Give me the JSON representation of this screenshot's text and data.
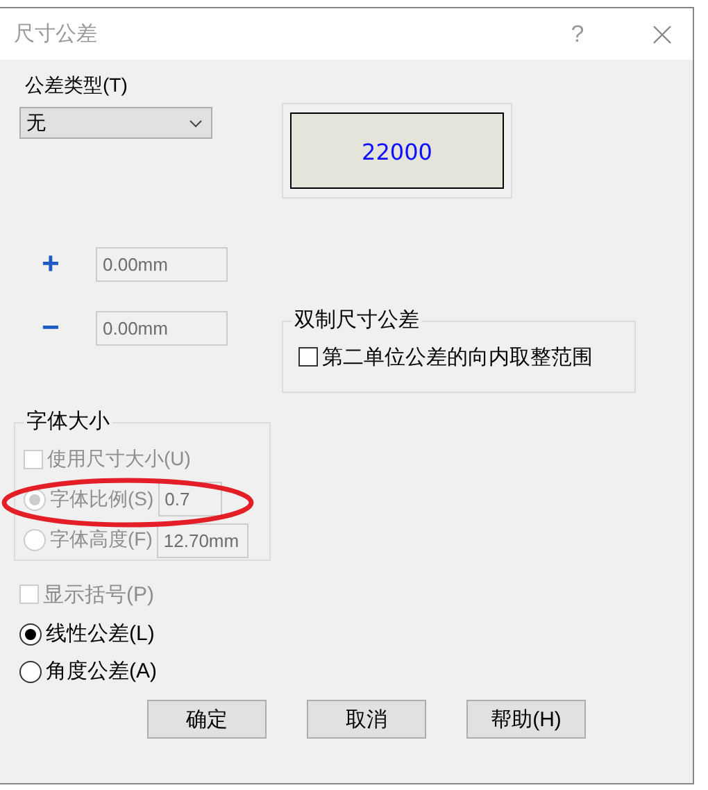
{
  "window": {
    "title": "尺寸公差",
    "help": "?"
  },
  "tolerance_type": {
    "label": "公差类型(T)",
    "value": "无"
  },
  "preview": {
    "text": "22000"
  },
  "limits": [
    {
      "sign": "+",
      "value": "0.00mm",
      "disabled": true
    },
    {
      "sign": "−",
      "value": "0.00mm",
      "disabled": true
    }
  ],
  "dual": {
    "title": "双制尺寸公差",
    "label": "第二单位公差的向内取整范围",
    "checked": false
  },
  "font_size": {
    "title": "字体大小",
    "options": [
      {
        "kind": "checkbox",
        "label": "使用尺寸大小(U)",
        "checked": false,
        "disabled": true
      },
      {
        "kind": "radio",
        "label": "字体比例(S)",
        "selected": true,
        "disabled": true,
        "value": "0.7"
      },
      {
        "kind": "radio",
        "label": "字体高度(F)",
        "selected": false,
        "disabled": true,
        "value": "12.70mm"
      }
    ]
  },
  "show_brackets": {
    "label": "显示括号(P)",
    "checked": false,
    "disabled": true
  },
  "tolerance_mode": [
    {
      "label": "线性公差(L)",
      "selected": true
    },
    {
      "label": "角度公差(A)",
      "selected": false
    }
  ],
  "buttons": [
    "确定",
    "取消",
    "帮助(H)"
  ]
}
